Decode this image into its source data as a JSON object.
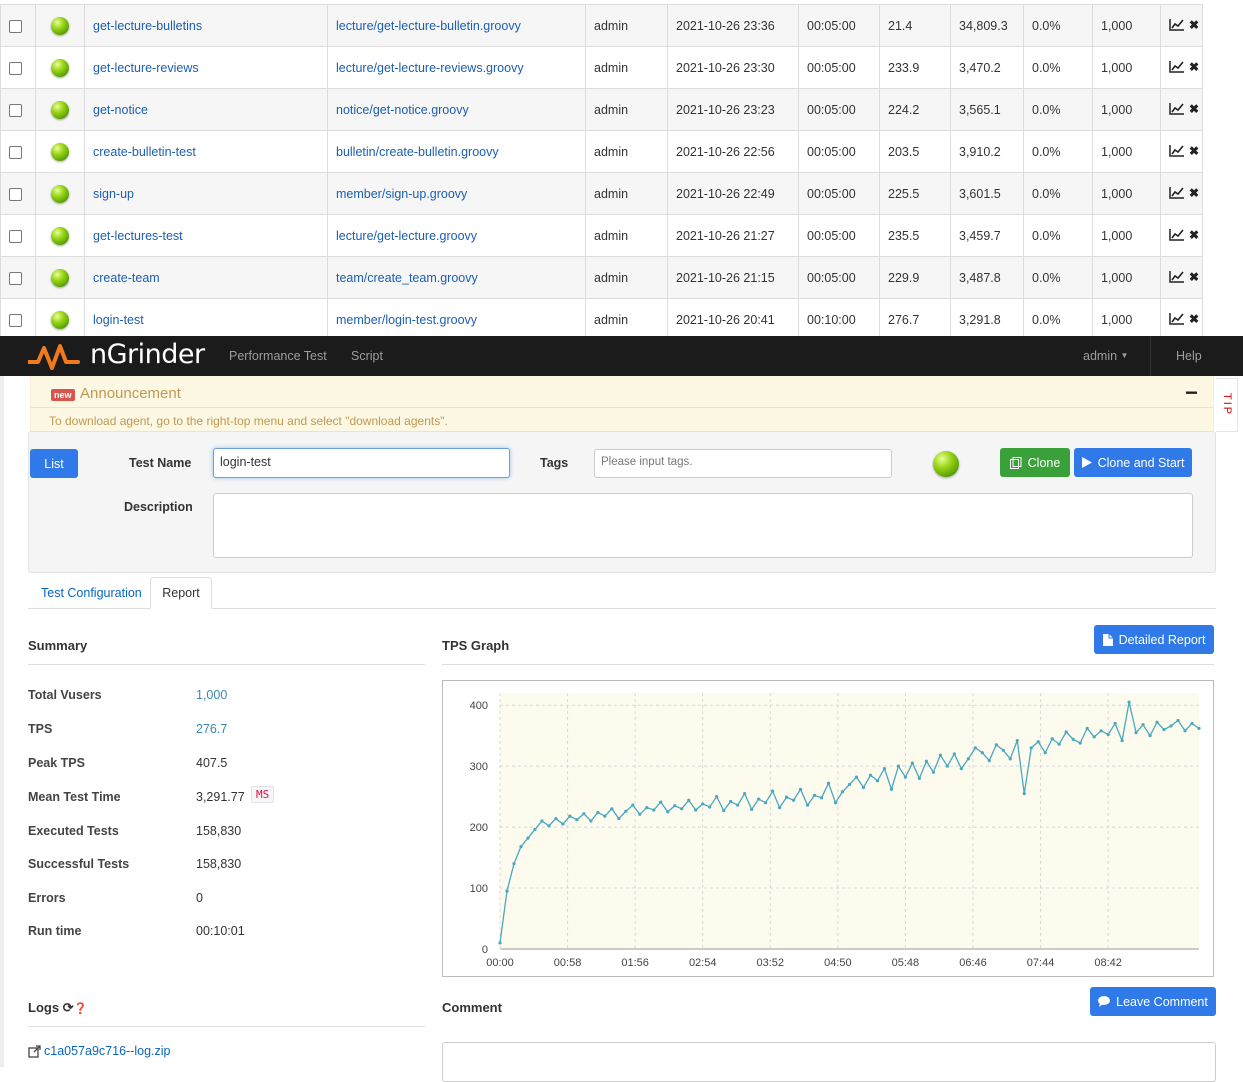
{
  "test_rows": [
    {
      "name": "get-lecture-bulletins",
      "script": "lecture/get-lecture-bulletin.groovy",
      "owner": "admin",
      "start": "2021-10-26 23:36",
      "duration": "00:05:00",
      "tps": "21.4",
      "mtt": "34,809.3",
      "error_rate": "0.0%",
      "vusers": "1,000"
    },
    {
      "name": "get-lecture-reviews",
      "script": "lecture/get-lecture-reviews.groovy",
      "owner": "admin",
      "start": "2021-10-26 23:30",
      "duration": "00:05:00",
      "tps": "233.9",
      "mtt": "3,470.2",
      "error_rate": "0.0%",
      "vusers": "1,000"
    },
    {
      "name": "get-notice",
      "script": "notice/get-notice.groovy",
      "owner": "admin",
      "start": "2021-10-26 23:23",
      "duration": "00:05:00",
      "tps": "224.2",
      "mtt": "3,565.1",
      "error_rate": "0.0%",
      "vusers": "1,000"
    },
    {
      "name": "create-bulletin-test",
      "script": "bulletin/create-bulletin.groovy",
      "owner": "admin",
      "start": "2021-10-26 22:56",
      "duration": "00:05:00",
      "tps": "203.5",
      "mtt": "3,910.2",
      "error_rate": "0.0%",
      "vusers": "1,000"
    },
    {
      "name": "sign-up",
      "script": "member/sign-up.groovy",
      "owner": "admin",
      "start": "2021-10-26 22:49",
      "duration": "00:05:00",
      "tps": "225.5",
      "mtt": "3,601.5",
      "error_rate": "0.0%",
      "vusers": "1,000"
    },
    {
      "name": "get-lectures-test",
      "script": "lecture/get-lecture.groovy",
      "owner": "admin",
      "start": "2021-10-26 21:27",
      "duration": "00:05:00",
      "tps": "235.5",
      "mtt": "3,459.7",
      "error_rate": "0.0%",
      "vusers": "1,000"
    },
    {
      "name": "create-team",
      "script": "team/create_team.groovy",
      "owner": "admin",
      "start": "2021-10-26 21:15",
      "duration": "00:05:00",
      "tps": "229.9",
      "mtt": "3,487.8",
      "error_rate": "0.0%",
      "vusers": "1,000"
    },
    {
      "name": "login-test",
      "script": "member/login-test.groovy",
      "owner": "admin",
      "start": "2021-10-26 20:41",
      "duration": "00:10:00",
      "tps": "276.7",
      "mtt": "3,291.8",
      "error_rate": "0.0%",
      "vusers": "1,000"
    }
  ],
  "navbar": {
    "brand": "nGrinder",
    "links": [
      "Performance Test",
      "Script"
    ],
    "user": "admin",
    "help": "Help"
  },
  "announcement": {
    "badge": "new",
    "title": "Announcement",
    "collapse": "−",
    "text": "To download agent, go to the right-top menu and select \"download agents\".",
    "tip": "TIP"
  },
  "form": {
    "list_button": "List",
    "test_name_label": "Test Name",
    "test_name_value": "login-test",
    "tags_label": "Tags",
    "tags_placeholder": "Please input tags.",
    "clone_button": "Clone",
    "clone_start_button": "Clone and Start",
    "description_label": "Description"
  },
  "tabs": {
    "config": "Test Configuration",
    "report": "Report"
  },
  "summary": {
    "title": "Summary",
    "rows": [
      {
        "label": "Total Vusers",
        "value": "1,000"
      },
      {
        "label": "TPS",
        "value": "276.7"
      },
      {
        "label": "Peak TPS",
        "value": "407.5"
      },
      {
        "label": "Mean Test Time",
        "value": "3,291.77"
      },
      {
        "label": "Executed Tests",
        "value": "158,830"
      },
      {
        "label": "Successful Tests",
        "value": "158,830"
      },
      {
        "label": "Errors",
        "value": "0"
      },
      {
        "label": "Run time",
        "value": "00:10:01"
      }
    ],
    "mtt_unit": "MS"
  },
  "graph": {
    "title": "TPS Graph",
    "detailed_report_button": "Detailed Report"
  },
  "logs": {
    "title": "Logs",
    "file": "c1a057a9c716--log.zip"
  },
  "comment": {
    "title": "Comment",
    "button": "Leave Comment"
  },
  "colors": {
    "accent": "#2f7ae8",
    "success": "#3aa03a",
    "line": "#4aa8c0",
    "plot_bg": "#fdfaee"
  },
  "chart_data": {
    "type": "line",
    "title": "",
    "xlabel": "",
    "ylabel": "",
    "x_ticks": [
      "00:00",
      "00:58",
      "01:56",
      "02:54",
      "03:52",
      "04:50",
      "05:48",
      "06:46",
      "07:44",
      "08:42"
    ],
    "y_ticks": [
      0,
      100,
      200,
      300,
      400
    ],
    "xlim_seconds": [
      0,
      600
    ],
    "ylim": [
      0,
      420
    ],
    "grid": true,
    "series": [
      {
        "name": "",
        "x_seconds": [
          0,
          6,
          12,
          18,
          24,
          30,
          36,
          42,
          48,
          54,
          60,
          66,
          72,
          78,
          84,
          90,
          96,
          102,
          108,
          114,
          120,
          126,
          132,
          138,
          144,
          150,
          156,
          162,
          168,
          174,
          180,
          186,
          192,
          198,
          204,
          210,
          216,
          222,
          228,
          234,
          240,
          246,
          252,
          258,
          264,
          270,
          276,
          282,
          288,
          294,
          300,
          306,
          312,
          318,
          324,
          330,
          336,
          342,
          348,
          354,
          360,
          366,
          372,
          378,
          384,
          390,
          396,
          402,
          408,
          414,
          420,
          426,
          432,
          438,
          444,
          450,
          456,
          462,
          468,
          474,
          480,
          486,
          492,
          498,
          504,
          510,
          516,
          522,
          528,
          534,
          540,
          546,
          552,
          558,
          564,
          570,
          576,
          582,
          588,
          594,
          600
        ],
        "values": [
          10,
          95,
          140,
          168,
          182,
          196,
          210,
          202,
          214,
          205,
          218,
          212,
          222,
          210,
          224,
          218,
          230,
          214,
          226,
          236,
          221,
          232,
          228,
          241,
          225,
          235,
          230,
          244,
          228,
          238,
          233,
          250,
          227,
          242,
          236,
          255,
          229,
          246,
          240,
          259,
          232,
          249,
          244,
          262,
          236,
          252,
          248,
          272,
          240,
          258,
          270,
          282,
          265,
          285,
          276,
          296,
          262,
          300,
          282,
          305,
          280,
          308,
          290,
          318,
          300,
          320,
          296,
          312,
          330,
          322,
          309,
          335,
          326,
          312,
          342,
          255,
          330,
          340,
          322,
          345,
          336,
          356,
          344,
          338,
          362,
          348,
          358,
          352,
          370,
          342,
          405,
          355,
          368,
          350,
          372,
          360,
          366,
          375,
          358,
          370,
          362
        ]
      }
    ]
  }
}
